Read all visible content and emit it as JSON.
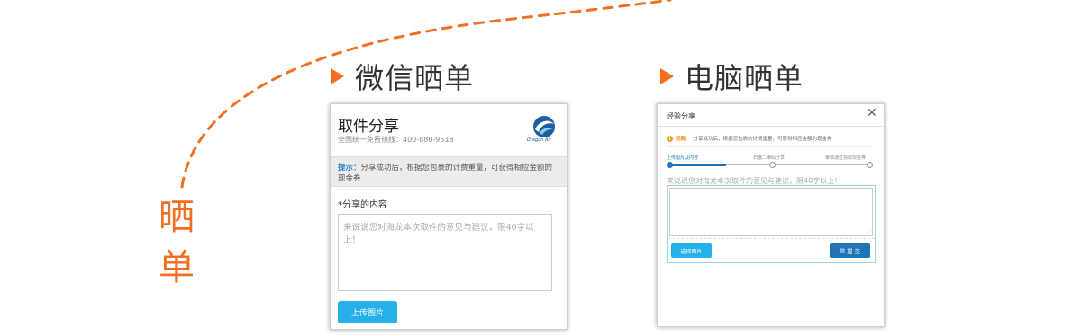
{
  "side_label": [
    "晒",
    "单"
  ],
  "sections": {
    "wechat": {
      "title": "微信晒单",
      "panel": {
        "title": "取件分享",
        "hotline": "全国统一免费热线：400-880-9518",
        "logo_text": "Dragon Air",
        "tip_label": "提示：",
        "tip_text": "分享成功后，根据您包裹的计费重量，可获得相应金额的现金券",
        "content_label": "*分享的内容",
        "placeholder": "来说说您对海龙本次取件的意见与建议，限40字以上！",
        "upload_button": "上传图片"
      }
    },
    "pc": {
      "title": "电脑晒单",
      "dialog": {
        "title": "经验分享",
        "close": "✕",
        "notice_label": "提醒：",
        "notice_text": "分享成功后，根据您包裹的计费重量，可获得相应金额的现金券",
        "steps": [
          "上传图片及内容",
          "扫描二维码分享",
          "审核通过领取现金券"
        ],
        "prompt": "来说说您对海龙本次取件的意见与建议，限40字以上！",
        "choose_button": "选择图片",
        "submit_button": "提 交"
      }
    }
  },
  "colors": {
    "accent": "#f26f21",
    "primary_blue": "#1f73b7",
    "button_blue": "#25b0ea"
  }
}
